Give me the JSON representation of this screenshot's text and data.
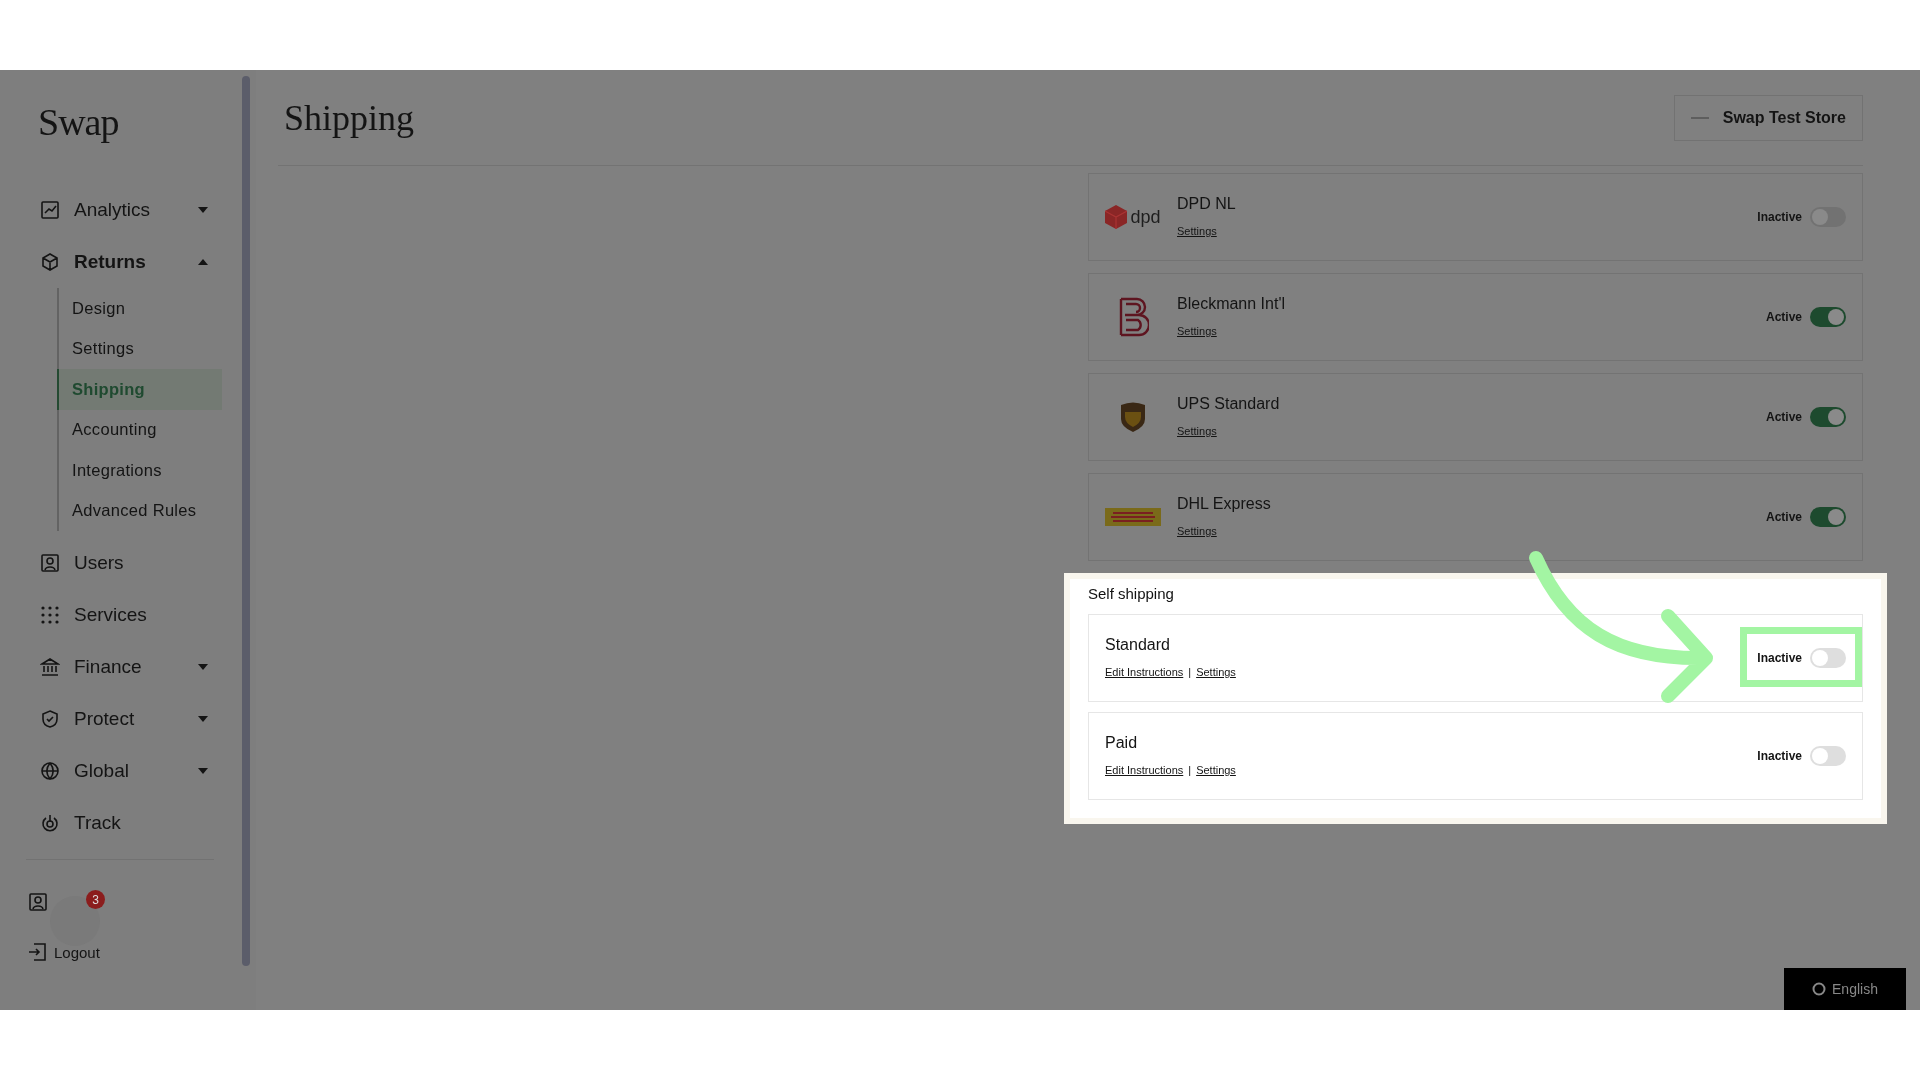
{
  "sidebar": {
    "logo": "Swap",
    "items": [
      {
        "label": "Analytics",
        "expandable": true,
        "expanded": false
      },
      {
        "label": "Returns",
        "expandable": true,
        "expanded": true,
        "children": [
          {
            "label": "Design",
            "selected": false
          },
          {
            "label": "Settings",
            "selected": false
          },
          {
            "label": "Shipping",
            "selected": true
          },
          {
            "label": "Accounting",
            "selected": false
          },
          {
            "label": "Integrations",
            "selected": false
          },
          {
            "label": "Advanced Rules",
            "selected": false
          }
        ]
      },
      {
        "label": "Users",
        "expandable": false,
        "expanded": false
      },
      {
        "label": "Services",
        "expandable": false,
        "expanded": false
      },
      {
        "label": "Finance",
        "expandable": true,
        "expanded": false
      },
      {
        "label": "Protect",
        "expandable": true,
        "expanded": false
      },
      {
        "label": "Global",
        "expandable": true,
        "expanded": false
      },
      {
        "label": "Track",
        "expandable": false,
        "expanded": false
      }
    ],
    "footer": {
      "badge": "3",
      "logout": "Logout"
    }
  },
  "header": {
    "title": "Shipping",
    "store": "Swap Test Store"
  },
  "carriers": [
    {
      "name": "DPD NL",
      "logo_text": "dpd",
      "link": "Settings",
      "status": "Inactive",
      "on": false
    },
    {
      "name": "Bleckmann Int'l",
      "link": "Settings",
      "status": "Active",
      "on": true
    },
    {
      "name": "UPS Standard",
      "link": "Settings",
      "status": "Active",
      "on": true
    },
    {
      "name": "DHL Express",
      "link": "Settings",
      "status": "Active",
      "on": true
    }
  ],
  "self_shipping": {
    "title": "Self shipping",
    "methods": [
      {
        "name": "Standard",
        "links": [
          "Edit Instructions",
          "Settings"
        ],
        "separator": "|",
        "status": "Inactive",
        "on": false,
        "highlighted": true
      },
      {
        "name": "Paid",
        "links": [
          "Edit Instructions",
          "Settings"
        ],
        "separator": "|",
        "status": "Inactive",
        "on": false,
        "highlighted": false
      }
    ]
  },
  "language": "English"
}
